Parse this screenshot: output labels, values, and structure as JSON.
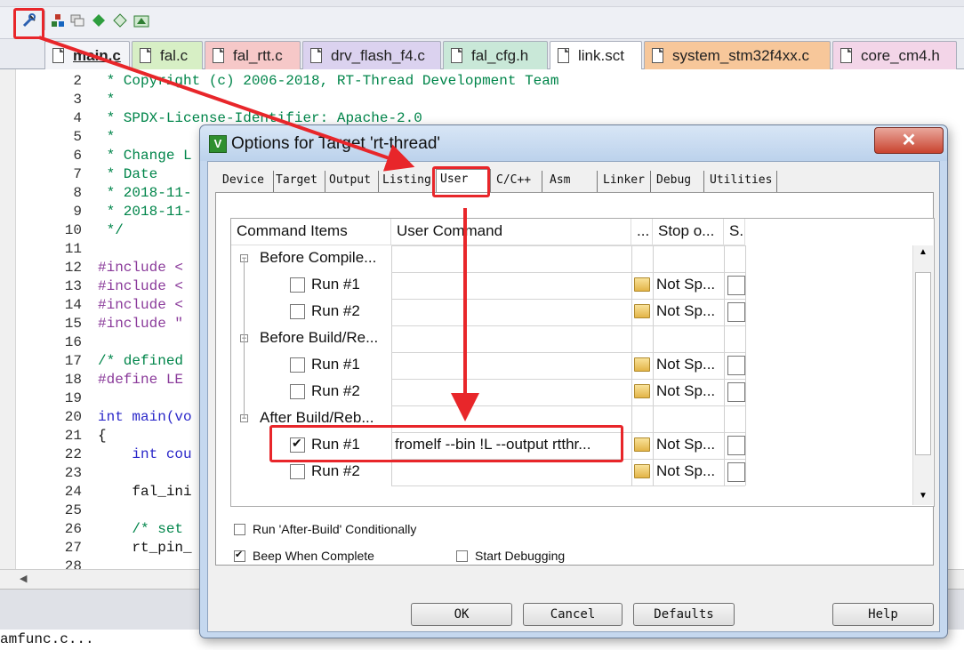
{
  "toolbar": {
    "icons": [
      "options-for-target-icon",
      "manage-project-items-icon",
      "select-packs-icon",
      "run-time-environment-icon",
      "pack-installer-icon",
      "batch-build-icon"
    ]
  },
  "file_tabs": [
    {
      "label": "main.c",
      "color": "#e9ebf1",
      "active": true
    },
    {
      "label": "fal.c",
      "color": "#d7efc5"
    },
    {
      "label": "fal_rtt.c",
      "color": "#f6c8c8"
    },
    {
      "label": "drv_flash_f4.c",
      "color": "#dbd2ef"
    },
    {
      "label": "fal_cfg.h",
      "color": "#c9e8d8"
    },
    {
      "label": "link.sct",
      "color": "#ffffff"
    },
    {
      "label": "system_stm32f4xx.c",
      "color": "#f7c79a"
    },
    {
      "label": "core_cm4.h",
      "color": "#f3d5e8"
    }
  ],
  "code_lines": [
    {
      "n": "2",
      "text": " * Copyright (c) 2006-2018, RT-Thread Development Team",
      "cls": "cm"
    },
    {
      "n": "3",
      "text": " *",
      "cls": "cm"
    },
    {
      "n": "4",
      "text": " * SPDX-License-Identifier: Apache-2.0",
      "cls": "cm"
    },
    {
      "n": "5",
      "text": " *",
      "cls": "cm"
    },
    {
      "n": "6",
      "text": " * Change L",
      "cls": "cm"
    },
    {
      "n": "7",
      "text": " * Date",
      "cls": "cm"
    },
    {
      "n": "8",
      "text": " * 2018-11-",
      "cls": "cm"
    },
    {
      "n": "9",
      "text": " * 2018-11-",
      "cls": "cm"
    },
    {
      "n": "10",
      "text": " */",
      "cls": "cm"
    },
    {
      "n": "11",
      "text": "",
      "cls": "plain"
    },
    {
      "n": "12",
      "text": "#include <",
      "cls": "pp"
    },
    {
      "n": "13",
      "text": "#include <",
      "cls": "pp"
    },
    {
      "n": "14",
      "text": "#include <",
      "cls": "pp"
    },
    {
      "n": "15",
      "text": "#include \"",
      "cls": "pp"
    },
    {
      "n": "16",
      "text": "",
      "cls": "plain"
    },
    {
      "n": "17",
      "text": "/* defined",
      "cls": "cm"
    },
    {
      "n": "18",
      "text": "#define LE",
      "cls": "pp"
    },
    {
      "n": "19",
      "text": "",
      "cls": "plain"
    },
    {
      "n": "20",
      "text": "int main(vo",
      "cls": "kw"
    },
    {
      "n": "21",
      "text": "{",
      "cls": "plain"
    },
    {
      "n": "22",
      "text": "    int cou",
      "cls": "kw"
    },
    {
      "n": "23",
      "text": "",
      "cls": "plain"
    },
    {
      "n": "24",
      "text": "    fal_ini",
      "cls": "plain"
    },
    {
      "n": "25",
      "text": "",
      "cls": "plain"
    },
    {
      "n": "26",
      "text": "    /* set",
      "cls": "cm"
    },
    {
      "n": "27",
      "text": "    rt_pin_",
      "cls": "plain"
    },
    {
      "n": "28",
      "text": "",
      "cls": "plain"
    }
  ],
  "bottom_text": "amfunc.c...",
  "dialog": {
    "title": "Options for Target 'rt-thread'",
    "close": "✕",
    "tabs": [
      "Device",
      "Target",
      "Output",
      "Listing",
      "User",
      "C/C++",
      "Asm",
      "Linker",
      "Debug",
      "Utilities"
    ],
    "active_tab": "User",
    "grid": {
      "headers": [
        "Command Items",
        "User Command",
        "...",
        "Stop o...",
        "S."
      ],
      "groups": [
        {
          "label": "Before Compile...",
          "runs": [
            {
              "label": "Run #1",
              "checked": false,
              "command": "",
              "stop": "Not Sp..."
            },
            {
              "label": "Run #2",
              "checked": false,
              "command": "",
              "stop": "Not Sp..."
            }
          ]
        },
        {
          "label": "Before Build/Re...",
          "runs": [
            {
              "label": "Run #1",
              "checked": false,
              "command": "",
              "stop": "Not Sp..."
            },
            {
              "label": "Run #2",
              "checked": false,
              "command": "",
              "stop": "Not Sp..."
            }
          ]
        },
        {
          "label": "After Build/Reb...",
          "runs": [
            {
              "label": "Run #1",
              "checked": true,
              "command": "fromelf --bin !L --output rtthr...",
              "stop": "Not Sp..."
            },
            {
              "label": "Run #2",
              "checked": false,
              "command": "",
              "stop": "Not Sp..."
            }
          ]
        }
      ]
    },
    "options": {
      "run_after_build": {
        "label": "Run 'After-Build' Conditionally",
        "checked": false
      },
      "beep": {
        "label": "Beep When Complete",
        "checked": true
      },
      "start_debug": {
        "label": "Start Debugging",
        "checked": false
      }
    },
    "buttons": {
      "ok": "OK",
      "cancel": "Cancel",
      "defaults": "Defaults",
      "help": "Help"
    }
  },
  "annotation_color": "#e8262a"
}
